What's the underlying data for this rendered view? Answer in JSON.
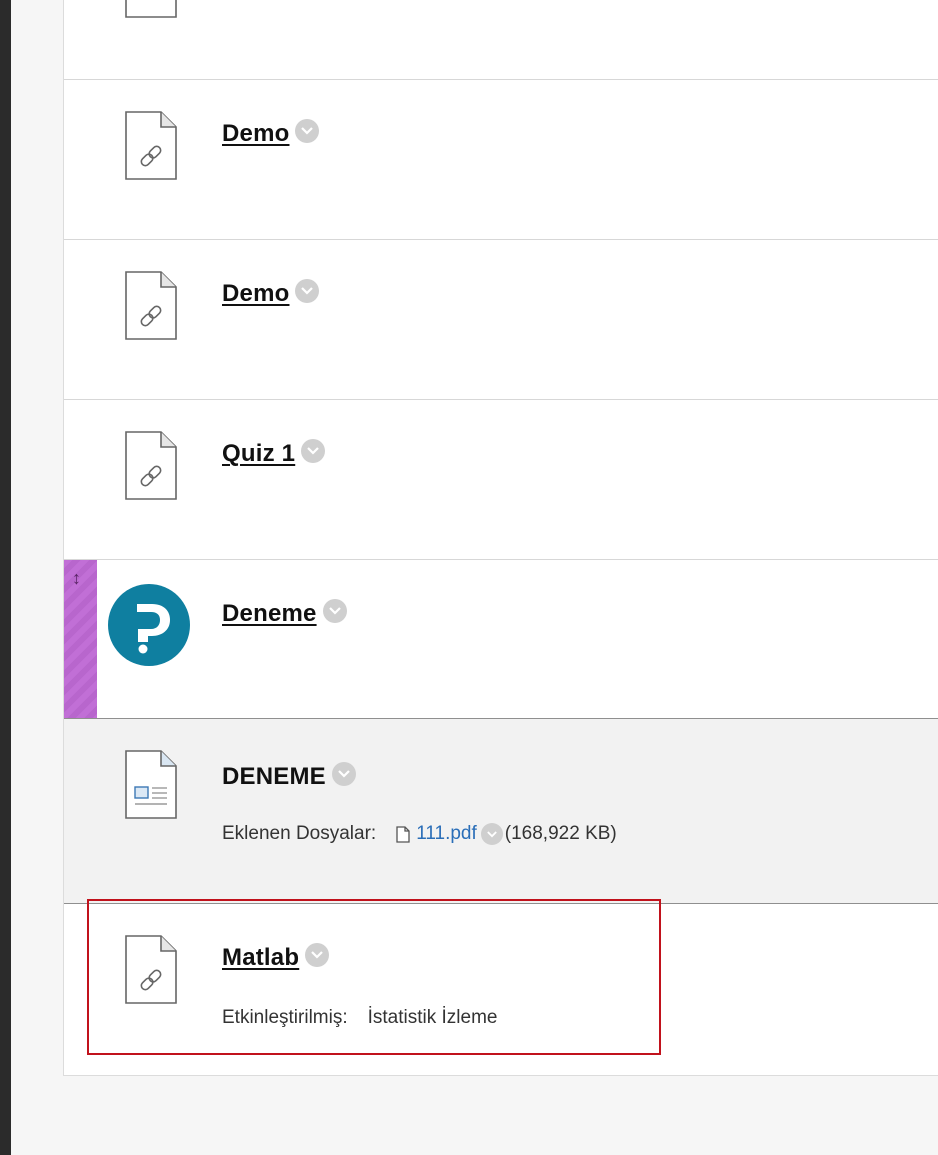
{
  "items": [
    {
      "title": "Demo",
      "type": "link",
      "icon": "link-file-icon"
    },
    {
      "title": "Demo",
      "type": "link",
      "icon": "link-file-icon"
    },
    {
      "title": "Quiz 1",
      "type": "link",
      "icon": "link-file-icon"
    },
    {
      "title": "Deneme",
      "type": "pearson",
      "icon": "pearson-logo"
    },
    {
      "title": "DENEME",
      "type": "document",
      "icon": "document-icon",
      "attached_label": "Eklenen Dosyalar:",
      "file_name": "111.pdf",
      "file_size": "(168,922 KB)"
    },
    {
      "title": "Matlab",
      "type": "link",
      "icon": "link-file-icon",
      "enabled_label": "Etkinleştirilmiş:",
      "enabled_value": "İstatistik İzleme"
    }
  ],
  "colors": {
    "accent_link": "#2a6eb8",
    "highlight_border": "#c1121c",
    "drag_handle": "#c16fd6",
    "pearson_blue": "#0f7fa0"
  },
  "icons": {
    "drag": "↕",
    "chevron": "chevron-down-icon",
    "file": "file-icon"
  }
}
